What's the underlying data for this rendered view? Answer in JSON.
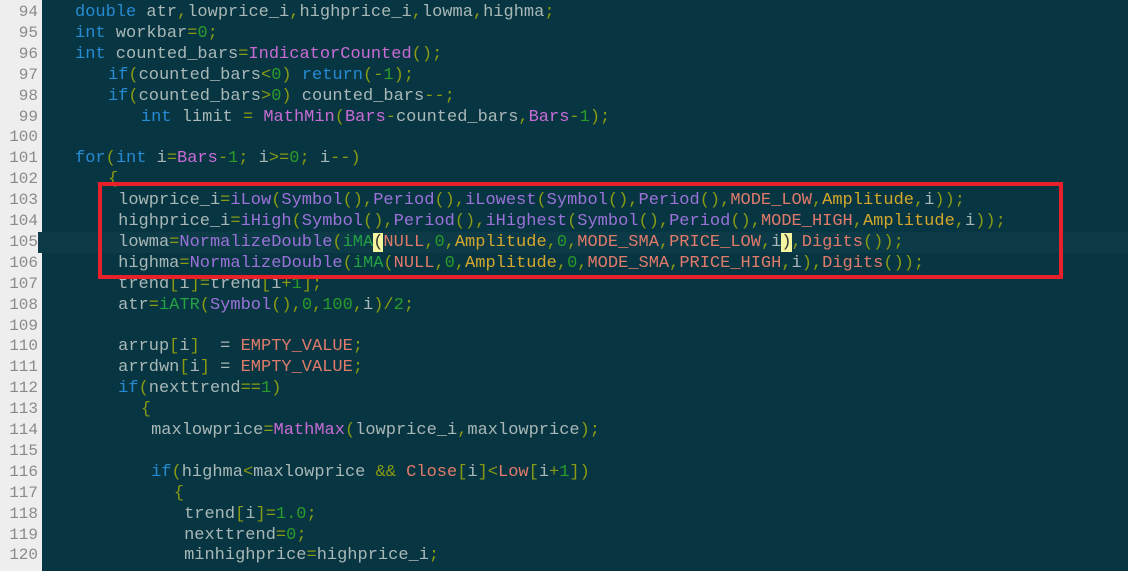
{
  "editor": {
    "current_line": 105,
    "highlight_box": {
      "from_line": 103,
      "to_line": 106,
      "color": "#e8202a"
    },
    "colors": {
      "background": "#073642",
      "gutter": "#eeeeee",
      "keyword": "#268bd2",
      "function": "#c86bd6",
      "number": "#2a9a2a",
      "punctuation": "#8a9a12",
      "constant": "#e07a6a",
      "identifier": "#a9b7b7"
    },
    "lines": [
      {
        "number": "94",
        "indent": 0,
        "tokens": [
          [
            "kw",
            "double"
          ],
          [
            "var",
            " atr"
          ],
          [
            "p",
            ","
          ],
          [
            "var",
            "lowprice_i"
          ],
          [
            "p",
            ","
          ],
          [
            "var",
            "highprice_i"
          ],
          [
            "p",
            ","
          ],
          [
            "var",
            "lowma"
          ],
          [
            "p",
            ","
          ],
          [
            "var",
            "highma"
          ],
          [
            "p",
            ";"
          ]
        ]
      },
      {
        "number": "95",
        "indent": 0,
        "tokens": [
          [
            "kw",
            "int"
          ],
          [
            "var",
            " workbar"
          ],
          [
            "p",
            "="
          ],
          [
            "num",
            "0"
          ],
          [
            "p",
            ";"
          ]
        ]
      },
      {
        "number": "96",
        "indent": 0,
        "tokens": [
          [
            "kw",
            "int"
          ],
          [
            "var",
            " counted_bars"
          ],
          [
            "p",
            "="
          ],
          [
            "fn",
            "IndicatorCounted"
          ],
          [
            "p",
            "();"
          ]
        ]
      },
      {
        "number": "97",
        "indent": 1,
        "tokens": [
          [
            "kw",
            "if"
          ],
          [
            "p",
            "("
          ],
          [
            "var",
            "counted_bars"
          ],
          [
            "p",
            "<"
          ],
          [
            "num",
            "0"
          ],
          [
            "p",
            ")"
          ],
          [
            "var",
            " "
          ],
          [
            "kw",
            "return"
          ],
          [
            "p",
            "(-"
          ],
          [
            "num",
            "1"
          ],
          [
            "p",
            ");"
          ]
        ]
      },
      {
        "number": "98",
        "indent": 1,
        "tokens": [
          [
            "kw",
            "if"
          ],
          [
            "p",
            "("
          ],
          [
            "var",
            "counted_bars"
          ],
          [
            "p",
            ">"
          ],
          [
            "num",
            "0"
          ],
          [
            "p",
            ")"
          ],
          [
            "var",
            " counted_bars"
          ],
          [
            "p",
            "--;"
          ]
        ]
      },
      {
        "number": "99",
        "indent": 2,
        "tokens": [
          [
            "kw",
            "int"
          ],
          [
            "var",
            " limit "
          ],
          [
            "p",
            "="
          ],
          [
            "var",
            " "
          ],
          [
            "fn",
            "MathMin"
          ],
          [
            "p",
            "("
          ],
          [
            "fn",
            "Bars"
          ],
          [
            "p",
            "-"
          ],
          [
            "var",
            "counted_bars"
          ],
          [
            "p",
            ","
          ],
          [
            "fn",
            "Bars"
          ],
          [
            "p",
            "-"
          ],
          [
            "num",
            "1"
          ],
          [
            "p",
            ");"
          ]
        ]
      },
      {
        "number": "100",
        "indent": 0,
        "tokens": []
      },
      {
        "number": "101",
        "indent": 0,
        "tokens": [
          [
            "kw",
            "for"
          ],
          [
            "p",
            "("
          ],
          [
            "kw",
            "int"
          ],
          [
            "var",
            " i"
          ],
          [
            "p",
            "="
          ],
          [
            "fn",
            "Bars"
          ],
          [
            "p",
            "-"
          ],
          [
            "num",
            "1"
          ],
          [
            "p",
            ";"
          ],
          [
            "var",
            " i"
          ],
          [
            "p",
            ">="
          ],
          [
            "num",
            "0"
          ],
          [
            "p",
            ";"
          ],
          [
            "var",
            " i"
          ],
          [
            "p",
            "--)"
          ]
        ]
      },
      {
        "number": "102",
        "indent": 1,
        "tokens": [
          [
            "p",
            "{"
          ]
        ]
      },
      {
        "number": "103",
        "indent": 1,
        "tokens": [
          [
            "var",
            " lowprice_i"
          ],
          [
            "p",
            "="
          ],
          [
            "fnb",
            "iLow"
          ],
          [
            "p",
            "("
          ],
          [
            "fnb",
            "Symbol"
          ],
          [
            "p",
            "(),"
          ],
          [
            "fnb",
            "Period"
          ],
          [
            "p",
            "(),"
          ],
          [
            "fnb",
            "iLowest"
          ],
          [
            "p",
            "("
          ],
          [
            "fnb",
            "Symbol"
          ],
          [
            "p",
            "(),"
          ],
          [
            "fnb",
            "Period"
          ],
          [
            "p",
            "(),"
          ],
          [
            "const",
            "MODE_LOW"
          ],
          [
            "p",
            ","
          ],
          [
            "amp",
            "Amplitude"
          ],
          [
            "p",
            ","
          ],
          [
            "var",
            "i"
          ],
          [
            "p",
            "));"
          ]
        ]
      },
      {
        "number": "104",
        "indent": 1,
        "tokens": [
          [
            "var",
            " highprice_i"
          ],
          [
            "p",
            "="
          ],
          [
            "fnb",
            "iHigh"
          ],
          [
            "p",
            "("
          ],
          [
            "fnb",
            "Symbol"
          ],
          [
            "p",
            "(),"
          ],
          [
            "fnb",
            "Period"
          ],
          [
            "p",
            "(),"
          ],
          [
            "fnb",
            "iHighest"
          ],
          [
            "p",
            "("
          ],
          [
            "fnb",
            "Symbol"
          ],
          [
            "p",
            "(),"
          ],
          [
            "fnb",
            "Period"
          ],
          [
            "p",
            "(),"
          ],
          [
            "const",
            "MODE_HIGH"
          ],
          [
            "p",
            ","
          ],
          [
            "amp",
            "Amplitude"
          ],
          [
            "p",
            ","
          ],
          [
            "var",
            "i"
          ],
          [
            "p",
            "));"
          ]
        ]
      },
      {
        "number": "105",
        "indent": 1,
        "tokens": [
          [
            "var",
            " lowma"
          ],
          [
            "p",
            "="
          ],
          [
            "fnb",
            "NormalizeDouble"
          ],
          [
            "p",
            "("
          ],
          [
            "gf",
            "iMA"
          ],
          [
            "bm",
            "("
          ],
          [
            "const",
            "NULL"
          ],
          [
            "p",
            ","
          ],
          [
            "num",
            "0"
          ],
          [
            "p",
            ","
          ],
          [
            "amp",
            "Amplitude"
          ],
          [
            "p",
            ","
          ],
          [
            "num",
            "0"
          ],
          [
            "p",
            ","
          ],
          [
            "const",
            "MODE_SMA"
          ],
          [
            "p",
            ","
          ],
          [
            "const",
            "PRICE_LOW"
          ],
          [
            "p",
            ","
          ],
          [
            "var",
            "i"
          ],
          [
            "bm",
            ")"
          ],
          [
            "p",
            ","
          ],
          [
            "const",
            "Digits"
          ],
          [
            "p",
            "());"
          ]
        ]
      },
      {
        "number": "106",
        "indent": 1,
        "tokens": [
          [
            "var",
            " highma"
          ],
          [
            "p",
            "="
          ],
          [
            "fnb",
            "NormalizeDouble"
          ],
          [
            "p",
            "("
          ],
          [
            "gf",
            "iMA"
          ],
          [
            "p",
            "("
          ],
          [
            "const",
            "NULL"
          ],
          [
            "p",
            ","
          ],
          [
            "num",
            "0"
          ],
          [
            "p",
            ","
          ],
          [
            "amp",
            "Amplitude"
          ],
          [
            "p",
            ","
          ],
          [
            "num",
            "0"
          ],
          [
            "p",
            ","
          ],
          [
            "const",
            "MODE_SMA"
          ],
          [
            "p",
            ","
          ],
          [
            "const",
            "PRICE_HIGH"
          ],
          [
            "p",
            ","
          ],
          [
            "var",
            "i"
          ],
          [
            "p",
            "),"
          ],
          [
            "const",
            "Digits"
          ],
          [
            "p",
            "());"
          ]
        ]
      },
      {
        "number": "107",
        "indent": 1,
        "tokens": [
          [
            "var",
            " trend"
          ],
          [
            "p",
            "["
          ],
          [
            "var",
            "i"
          ],
          [
            "p",
            "]="
          ],
          [
            "var",
            "trend"
          ],
          [
            "p",
            "["
          ],
          [
            "var",
            "i"
          ],
          [
            "p",
            "+"
          ],
          [
            "num",
            "1"
          ],
          [
            "p",
            "];"
          ]
        ]
      },
      {
        "number": "108",
        "indent": 1,
        "tokens": [
          [
            "var",
            " atr"
          ],
          [
            "p",
            "="
          ],
          [
            "gf",
            "iATR"
          ],
          [
            "p",
            "("
          ],
          [
            "fnb",
            "Symbol"
          ],
          [
            "p",
            "(),"
          ],
          [
            "num",
            "0"
          ],
          [
            "p",
            ","
          ],
          [
            "num",
            "100"
          ],
          [
            "p",
            ","
          ],
          [
            "var",
            "i"
          ],
          [
            "p",
            ")/"
          ],
          [
            "num",
            "2"
          ],
          [
            "p",
            ";"
          ]
        ]
      },
      {
        "number": "109",
        "indent": 0,
        "tokens": []
      },
      {
        "number": "110",
        "indent": 1,
        "tokens": [
          [
            "var",
            " arrup"
          ],
          [
            "p",
            "["
          ],
          [
            "var",
            "i"
          ],
          [
            "p",
            "]"
          ],
          [
            "var",
            "  = "
          ],
          [
            "const",
            "EMPTY_VALUE"
          ],
          [
            "p",
            ";"
          ]
        ]
      },
      {
        "number": "111",
        "indent": 1,
        "tokens": [
          [
            "var",
            " arrdwn"
          ],
          [
            "p",
            "["
          ],
          [
            "var",
            "i"
          ],
          [
            "p",
            "]"
          ],
          [
            "var",
            " = "
          ],
          [
            "const",
            "EMPTY_VALUE"
          ],
          [
            "p",
            ";"
          ]
        ]
      },
      {
        "number": "112",
        "indent": 1,
        "tokens": [
          [
            "var",
            " "
          ],
          [
            "kw",
            "if"
          ],
          [
            "p",
            "("
          ],
          [
            "var",
            "nexttrend"
          ],
          [
            "p",
            "=="
          ],
          [
            "num",
            "1"
          ],
          [
            "p",
            ")"
          ]
        ]
      },
      {
        "number": "113",
        "indent": 2,
        "tokens": [
          [
            "p",
            "{"
          ]
        ]
      },
      {
        "number": "114",
        "indent": 2,
        "tokens": [
          [
            "var",
            " maxlowprice"
          ],
          [
            "p",
            "="
          ],
          [
            "fn",
            "MathMax"
          ],
          [
            "p",
            "("
          ],
          [
            "var",
            "lowprice_i"
          ],
          [
            "p",
            ","
          ],
          [
            "var",
            "maxlowprice"
          ],
          [
            "p",
            ");"
          ]
        ]
      },
      {
        "number": "115",
        "indent": 0,
        "tokens": []
      },
      {
        "number": "116",
        "indent": 2,
        "tokens": [
          [
            "var",
            " "
          ],
          [
            "kw",
            "if"
          ],
          [
            "p",
            "("
          ],
          [
            "var",
            "highma"
          ],
          [
            "p",
            "<"
          ],
          [
            "var",
            "maxlowprice "
          ],
          [
            "p",
            "&&"
          ],
          [
            "var",
            " "
          ],
          [
            "const",
            "Close"
          ],
          [
            "p",
            "["
          ],
          [
            "var",
            "i"
          ],
          [
            "p",
            "]<"
          ],
          [
            "const",
            "Low"
          ],
          [
            "p",
            "["
          ],
          [
            "var",
            "i"
          ],
          [
            "p",
            "+"
          ],
          [
            "num",
            "1"
          ],
          [
            "p",
            "])"
          ]
        ]
      },
      {
        "number": "117",
        "indent": 3,
        "tokens": [
          [
            "p",
            "{"
          ]
        ]
      },
      {
        "number": "118",
        "indent": 3,
        "tokens": [
          [
            "var",
            " trend"
          ],
          [
            "p",
            "["
          ],
          [
            "var",
            "i"
          ],
          [
            "p",
            "]="
          ],
          [
            "num",
            "1.0"
          ],
          [
            "p",
            ";"
          ]
        ]
      },
      {
        "number": "119",
        "indent": 3,
        "tokens": [
          [
            "var",
            " nexttrend"
          ],
          [
            "p",
            "="
          ],
          [
            "num",
            "0"
          ],
          [
            "p",
            ";"
          ]
        ]
      },
      {
        "number": "120",
        "indent": 3,
        "tokens": [
          [
            "var",
            " minhighprice"
          ],
          [
            "p",
            "="
          ],
          [
            "var",
            "highprice_i"
          ],
          [
            "p",
            ";"
          ]
        ]
      }
    ]
  }
}
